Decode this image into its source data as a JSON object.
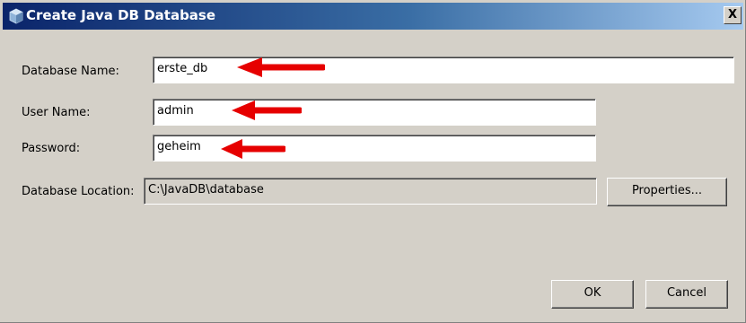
{
  "window": {
    "title": "Create Java DB Database",
    "close_label": "X"
  },
  "form": {
    "database_name_label": "Database Name:",
    "database_name_value": "erste_db",
    "user_name_label": "User Name:",
    "user_name_value": "admin",
    "password_label": "Password:",
    "password_value": "geheim",
    "location_label": "Database Location:",
    "location_value": "C:\\JavaDB\\database"
  },
  "buttons": {
    "properties_label": "Properties...",
    "ok_label": "OK",
    "cancel_label": "Cancel"
  },
  "colors": {
    "titlebar_start": "#0a246a",
    "titlebar_end": "#a6caf0",
    "annotation_arrow": "#e60000",
    "dialog_background": "#d4d0c8"
  },
  "icons": [
    "java-db-icon",
    "close-icon",
    "red-arrow-annotation"
  ]
}
